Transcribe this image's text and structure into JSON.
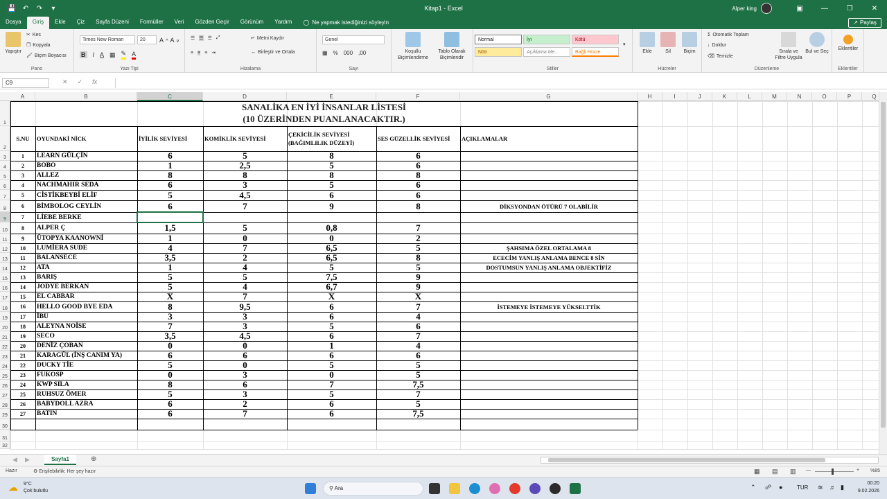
{
  "window": {
    "title": "Kitap1 - Excel",
    "user": "Alper king"
  },
  "menu": {
    "items": [
      "Dosya",
      "Giriş",
      "Ekle",
      "Çiz",
      "Sayfa Düzeni",
      "Formüller",
      "Veri",
      "Gözden Geçir",
      "Görünüm",
      "Yardım"
    ],
    "active": "Giriş",
    "tell_me": "Ne yapmak istediğinizi söyleyin",
    "share": "Paylaş"
  },
  "ribbon": {
    "paste": "Yapıştır",
    "cut": "Kes",
    "copy": "Kopyala",
    "format_painter": "Biçim Boyacısı",
    "clipboard": "Pano",
    "font_name": "Times New Roman",
    "font_size": "20",
    "font_group": "Yazı Tipi",
    "wrap_text": "Metni Kaydır",
    "merge_center": "Birleştir ve Ortala",
    "alignment": "Hizalama",
    "number_format": "Genel",
    "number": "Sayı",
    "cond_format": "Koşullu Biçimlendirme",
    "format_table": "Tablo Olarak Biçimlendir",
    "styles": {
      "normal": "Normal",
      "good": "İyi",
      "bad": "Kötü",
      "neutral": "Nötr",
      "explanatory": "Açıklama Me...",
      "linked": "Bağlı Hücre"
    },
    "styles_group": "Stiller",
    "insert": "Ekle",
    "delete": "Sil",
    "format": "Biçim",
    "cells": "Hücreler",
    "autosum": "Otomatik Toplam",
    "fill": "Doldur",
    "clear": "Temizle",
    "sort_filter": "Sırala ve Filtre Uygula",
    "find_select": "Bul ve Seç",
    "editing": "Düzenleme",
    "addins": "Eklentiler",
    "addins_group": "Eklentiler"
  },
  "formula_bar": {
    "name_box": "C9",
    "formula": ""
  },
  "columns": [
    "A",
    "B",
    "C",
    "D",
    "E",
    "F",
    "G",
    "H",
    "I",
    "J",
    "K",
    "L",
    "M",
    "N",
    "O",
    "P",
    "Q"
  ],
  "selected_column": "C",
  "selected_row": "9",
  "sheet": {
    "title_line1": "SANALİKA EN İYİ İNSANLAR LİSTESİ",
    "title_line2": "(10 ÜZERİNDEN PUANLANACAKTIR.)",
    "headers": [
      "S.NU",
      "OYUNDAKİ NİCK",
      "İYİLİK SEVİYESİ",
      "KOMİKLİK SEVİYESİ",
      "ÇEKİCİLİK SEVİYESİ (BAĞIMLILIK DÜZEYİ)",
      "SES GÜZELLİK SEVİYESİ",
      "AÇIKLAMALAR"
    ],
    "rows": [
      [
        "1",
        "LEARN GÜLÇİN",
        "6",
        "5",
        "8",
        "6",
        ""
      ],
      [
        "2",
        "BOBO",
        "1",
        "2,5",
        "5",
        "6",
        ""
      ],
      [
        "3",
        "ALLEZ",
        "8",
        "8",
        "8",
        "8",
        ""
      ],
      [
        "4",
        "NACHMAHIR SEDA",
        "6",
        "3",
        "5",
        "6",
        ""
      ],
      [
        "5",
        "CİSTİKBEYBİ ELİF",
        "5",
        "4,5",
        "6",
        "6",
        ""
      ],
      [
        "6",
        "BİMBOLOG CEYLİN",
        "6",
        "7",
        "9",
        "8",
        "DİKSYONDAN ÖTÜRÜ 7 OLABİLİR"
      ],
      [
        "7",
        "LİEBE BERKE",
        "",
        "",
        "",
        "",
        ""
      ],
      [
        "8",
        "ALPER Ç",
        "1,5",
        "5",
        "0,8",
        "7",
        ""
      ],
      [
        "9",
        "ÜTOPYA KAANOWNİ",
        "1",
        "0",
        "0",
        "2",
        ""
      ],
      [
        "10",
        "LUMİERA SUDE",
        "4",
        "7",
        "6,5",
        "5",
        "ŞAHSIMA ÖZEL ORTALAMA 8"
      ],
      [
        "11",
        "BALANSECE",
        "3,5",
        "2",
        "6,5",
        "8",
        "ECECİM YANLIŞ ANLAMA BENCE 8 SİN"
      ],
      [
        "12",
        "ATA",
        "1",
        "4",
        "5",
        "5",
        "DOSTUMSUN YANLIŞ ANLAMA OBJEKTİFİZ"
      ],
      [
        "13",
        "BARIŞ",
        "5",
        "5",
        "7,5",
        "9",
        ""
      ],
      [
        "14",
        "JODYE BERKAN",
        "5",
        "4",
        "6,7",
        "9",
        ""
      ],
      [
        "15",
        "EL CABBAR",
        "X",
        "7",
        "X",
        "X",
        ""
      ],
      [
        "16",
        "HELLO GOOD BYE EDA",
        "8",
        "9,5",
        "6",
        "7",
        "İSTEMEYE İSTEMEYE YÜKSELTTİK"
      ],
      [
        "17",
        "İBU",
        "3",
        "3",
        "6",
        "4",
        ""
      ],
      [
        "18",
        "ALEYNA NOİSE",
        "7",
        "3",
        "5",
        "6",
        ""
      ],
      [
        "19",
        "SECO",
        "3,5",
        "4,5",
        "6",
        "7",
        ""
      ],
      [
        "20",
        "DENİZ ÇOBAN",
        "0",
        "0",
        "1",
        "4",
        ""
      ],
      [
        "21",
        "KARAGÜL (İNŞ CANIM YA)",
        "6",
        "6",
        "6",
        "6",
        ""
      ],
      [
        "22",
        "DUCKY TİE",
        "5",
        "0",
        "5",
        "5",
        ""
      ],
      [
        "23",
        "FUKOSP",
        "0",
        "3",
        "0",
        "5",
        ""
      ],
      [
        "24",
        "KWP SILA",
        "8",
        "6",
        "7",
        "7,5",
        ""
      ],
      [
        "25",
        "RUHSUZ ÖMER",
        "5",
        "3",
        "5",
        "7",
        ""
      ],
      [
        "26",
        "BABYDOLL AZRA",
        "6",
        "2",
        "6",
        "5",
        ""
      ],
      [
        "27",
        "BATIN",
        "6",
        "7",
        "6",
        "7,5",
        ""
      ]
    ]
  },
  "sheet_tab": "Sayfa1",
  "status": {
    "ready": "Hazır",
    "accessibility": "Erişilebilirlik: Her şey hazır",
    "zoom": "%85"
  },
  "taskbar": {
    "weather_temp": "9°C",
    "weather_desc": "Çok bulutlu",
    "search": "Ara",
    "lang": "TUR",
    "time": "00:20",
    "date": "9.02.2026"
  }
}
